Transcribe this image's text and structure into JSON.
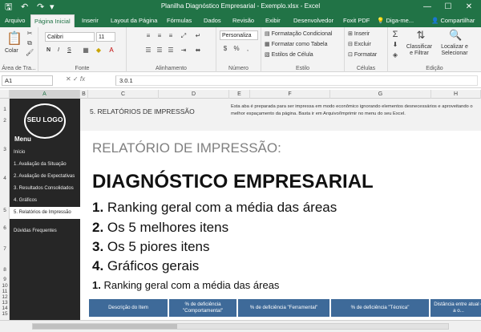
{
  "titlebar": {
    "title": "Planilha Diagnóstico Empresarial - Exemplo.xlsx - Excel",
    "quick_access": {
      "save": "🖫",
      "undo": "↶",
      "redo": "↷",
      "customize": "▾"
    },
    "minimize": "—",
    "maximize": "☐",
    "close": "✕"
  },
  "tabs": [
    {
      "label": "Arquivo"
    },
    {
      "label": "Página Inicial",
      "active": true
    },
    {
      "label": "Inserir"
    },
    {
      "label": "Layout da Página"
    },
    {
      "label": "Fórmulas"
    },
    {
      "label": "Dados"
    },
    {
      "label": "Revisão"
    },
    {
      "label": "Exibir"
    },
    {
      "label": "Desenvolvedor"
    },
    {
      "label": "Foxit PDF"
    },
    {
      "label": "Diga-me..."
    },
    {
      "label": "Compartilhar"
    }
  ],
  "ribbon": {
    "clipboard": {
      "paste": "Colar",
      "label": "Área de Tra..."
    },
    "font": {
      "name": "Calibri",
      "size": "11",
      "bold": "N",
      "italic": "I",
      "underline": "S",
      "label": "Fonte"
    },
    "alignment": {
      "label": "Alinhamento"
    },
    "number": {
      "format": "Personaliza",
      "label": "Número"
    },
    "styles": {
      "conditional": "Formatação Condicional",
      "as_table": "Formatar como Tabela",
      "cell_styles": "Estilos de Célula",
      "label": "Estilo"
    },
    "cells": {
      "insert": "Inserir",
      "delete": "Excluir",
      "format": "Formatar",
      "label": "Células"
    },
    "editing": {
      "sort_filter": "Classificar e Filtrar",
      "find_select": "Localizar e Selecionar",
      "label": "Edição"
    }
  },
  "formula_bar": {
    "name_box": "A1",
    "fx": "fx",
    "value": "3.0.1"
  },
  "columns": [
    "A",
    "B",
    "C",
    "D",
    "E",
    "F",
    "G",
    "H"
  ],
  "rows": [
    "1",
    "2",
    "3",
    "4",
    "5",
    "6",
    "7",
    "8",
    "9",
    "10",
    "11",
    "12",
    "13",
    "14",
    "15"
  ],
  "sidebar": {
    "logo": "SEU LOGO",
    "menu_title": "Menu",
    "items": [
      {
        "label": "Início"
      },
      {
        "label": "1. Avaliação da Situação"
      },
      {
        "label": "2. Avaliação de Expectativas"
      },
      {
        "label": "3. Resultados Consolidados"
      },
      {
        "label": "4. Gráficos"
      },
      {
        "label": "5. Relatórios de Impressão",
        "active": true
      },
      {
        "label": "Dúvidas Frequentes"
      }
    ]
  },
  "content": {
    "section_title": "5. RELATÓRIOS DE IMPRESSÃO",
    "note": "Esta aba é preparada para ser impressa em modo econômico ignorando elementos desnecessários e aproveitando o melhor espaçamento da página. Basta ir em Arquivo/Imprimir no menu do seu Excel.",
    "subhead": "RELATÓRIO DE IMPRESSÃO:",
    "mainhead": "DIAGNÓSTICO EMPRESARIAL",
    "items": [
      {
        "num": "1.",
        "text": "Ranking geral com a média das áreas"
      },
      {
        "num": "2.",
        "text": "Os 5 melhores itens"
      },
      {
        "num": "3.",
        "text": "Os 5 piores itens"
      },
      {
        "num": "4.",
        "text": "Gráficos gerais"
      }
    ],
    "small_item": {
      "num": "1.",
      "text": "Ranking geral com a média das áreas"
    },
    "table_headers": [
      "Descrição do Item",
      "% de deficiência \"Comportamental\"",
      "% de deficiência \"Ferramental\"",
      "% de deficiência \"Técnica\"",
      "Distância entre atual e a o..."
    ]
  },
  "colors": {
    "excel_green": "#217346",
    "sidebar_bg": "#262626",
    "table_header": "#3e6a99"
  }
}
